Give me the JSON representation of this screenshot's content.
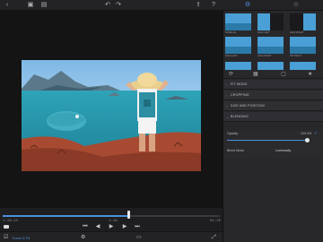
{
  "colors": {
    "accent": "#4a90d9",
    "panel_bg": "#28282b",
    "stage_bg": "#141414"
  },
  "toolbar": {
    "left_icons": [
      "back-icon",
      "layers-icon",
      "film-icon"
    ],
    "center_icons": [
      "undo-icon",
      "redo-icon"
    ],
    "right_icons": [
      "export-icon",
      "help-icon"
    ],
    "panel_icons": [
      "adjust-icon",
      "favorite-star-icon"
    ]
  },
  "timeline": {
    "start_time": "1:18:13",
    "current_time": "1:18",
    "end_time": "01:35"
  },
  "bottombar": {
    "project_label": "Travel & Fit",
    "icons": [
      "checklist-icon",
      "settings-icon",
      "aspect-icon",
      "fullscreen-icon"
    ]
  },
  "presets": [
    {
      "label": "NONE-ALL"
    },
    {
      "label": "HALF LEFT"
    },
    {
      "label": "HALF RIGHT"
    },
    {
      "label": "HALF-LEFT"
    },
    {
      "label": "HALF-RIGHT"
    },
    {
      "label": "PIP RIGHT"
    },
    {
      "label": "PIP-LEFT"
    },
    {
      "label": "TOP RIGHT"
    },
    {
      "label": "TOP LEFT"
    }
  ],
  "sections": {
    "fit_mode": "FIT MODE",
    "cropping": "CROPPING",
    "size_position": "SIZE AND POSITION",
    "blending": "BLENDING"
  },
  "blending": {
    "opacity_label": "Opacity",
    "opacity_value": "100.0%",
    "opacity_fraction": 1.0,
    "blend_mode_label": "Blend Mode",
    "blend_mode_value": "Luminosity"
  }
}
